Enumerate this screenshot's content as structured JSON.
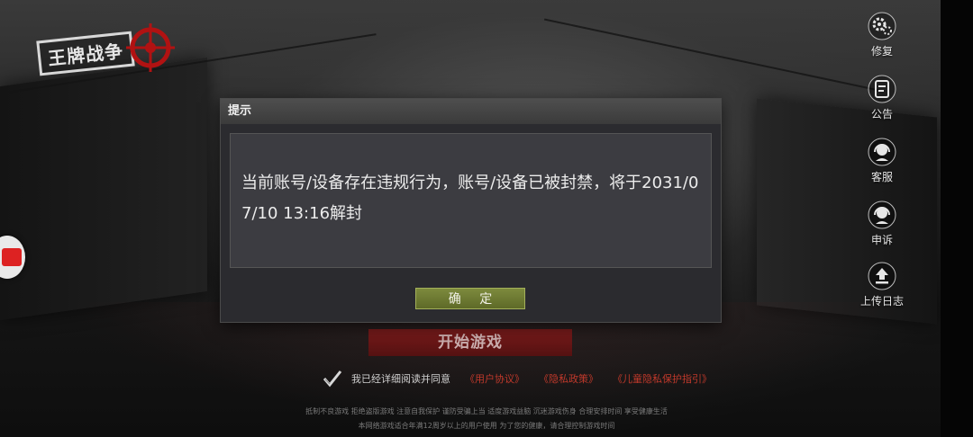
{
  "logo": {
    "text": "王牌战争"
  },
  "side_menu": [
    {
      "label": "修复",
      "icon": "gear-icon"
    },
    {
      "label": "公告",
      "icon": "notice-icon"
    },
    {
      "label": "客服",
      "icon": "headset-icon"
    },
    {
      "label": "申诉",
      "icon": "appeal-headset-icon"
    },
    {
      "label": "上传日志",
      "icon": "upload-icon"
    }
  ],
  "dialog": {
    "title": "提示",
    "message": "当前账号/设备存在违规行为，账号/设备已被封禁，将于2031/07/10 13:16解封",
    "confirm_label": "确 定"
  },
  "start_button_label": "开始游戏",
  "agreement": {
    "text": "我已经详细阅读并同意",
    "links": [
      "《用户协议》",
      "《隐私政策》",
      "《儿童隐私保护指引》"
    ]
  },
  "footer": {
    "line1": "抵制不良游戏  拒绝盗版游戏  注意自我保护  谨防受骗上当  适度游戏益脑  沉迷游戏伤身  合理安排时间  享受健康生活",
    "line2": "本网络游戏适合年满12周岁以上的用户使用    为了您的健康，请合理控制游戏时间"
  },
  "colors": {
    "dialog_bg": "#2b2b2f",
    "confirm_button": "#6e7b33",
    "start_button": "#7a1616",
    "link_red": "#c0392b"
  }
}
